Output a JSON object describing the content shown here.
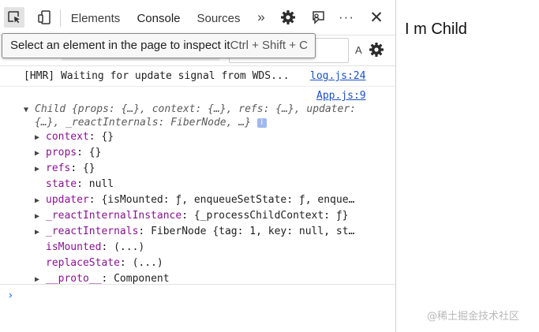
{
  "devtools": {
    "tabs": {
      "elements": "Elements",
      "console": "Console",
      "sources": "Sources"
    },
    "icons": {
      "inspect": "inspect-element-icon",
      "device": "device-toolbar-icon",
      "more_tabs": "chevron-double-right-icon",
      "settings": "gear-icon",
      "feedback": "feedback-icon",
      "menu": "more-options-icon",
      "close": "close-icon"
    },
    "more_tabs_glyph": "»",
    "menu_glyph": "···",
    "close_glyph": "✕",
    "tooltip": {
      "text": "Select an element in the page to inspect it",
      "shortcut": "Ctrl + Shift + C"
    },
    "subbar_letter": "A",
    "accent_color": "#1a73e8"
  },
  "console": {
    "hmr_message": "[HMR] Waiting for update signal from WDS...",
    "hmr_source": "log.js:24",
    "log_source": "App.js:9",
    "object_summary_line1": "Child {props: {…}, context: {…}, refs: {…}, updater:",
    "object_summary_line2": "{…}, _reactInternals: FiberNode, …}",
    "info_badge": "i",
    "properties": [
      {
        "expandable": true,
        "key": "context",
        "value": "{}"
      },
      {
        "expandable": true,
        "key": "props",
        "value": "{}"
      },
      {
        "expandable": true,
        "key": "refs",
        "value": "{}"
      },
      {
        "expandable": false,
        "key": "state",
        "value": "null"
      },
      {
        "expandable": true,
        "key": "updater",
        "value": "{isMounted: ƒ, enqueueSetState: ƒ, enque…"
      },
      {
        "expandable": true,
        "key": "_reactInternalInstance",
        "value": "{_processChildContext: ƒ}"
      },
      {
        "expandable": true,
        "key": "_reactInternals",
        "value": "FiberNode {tag: 1, key: null, st…"
      },
      {
        "expandable": false,
        "key": "isMounted",
        "value": "(...)"
      },
      {
        "expandable": false,
        "key": "replaceState",
        "value": "(...)"
      },
      {
        "expandable": true,
        "key": "__proto__",
        "value": "Component"
      }
    ],
    "prompt_glyph": "›"
  },
  "page": {
    "text": "I m Child",
    "watermark": "@稀土掘金技术社区"
  }
}
